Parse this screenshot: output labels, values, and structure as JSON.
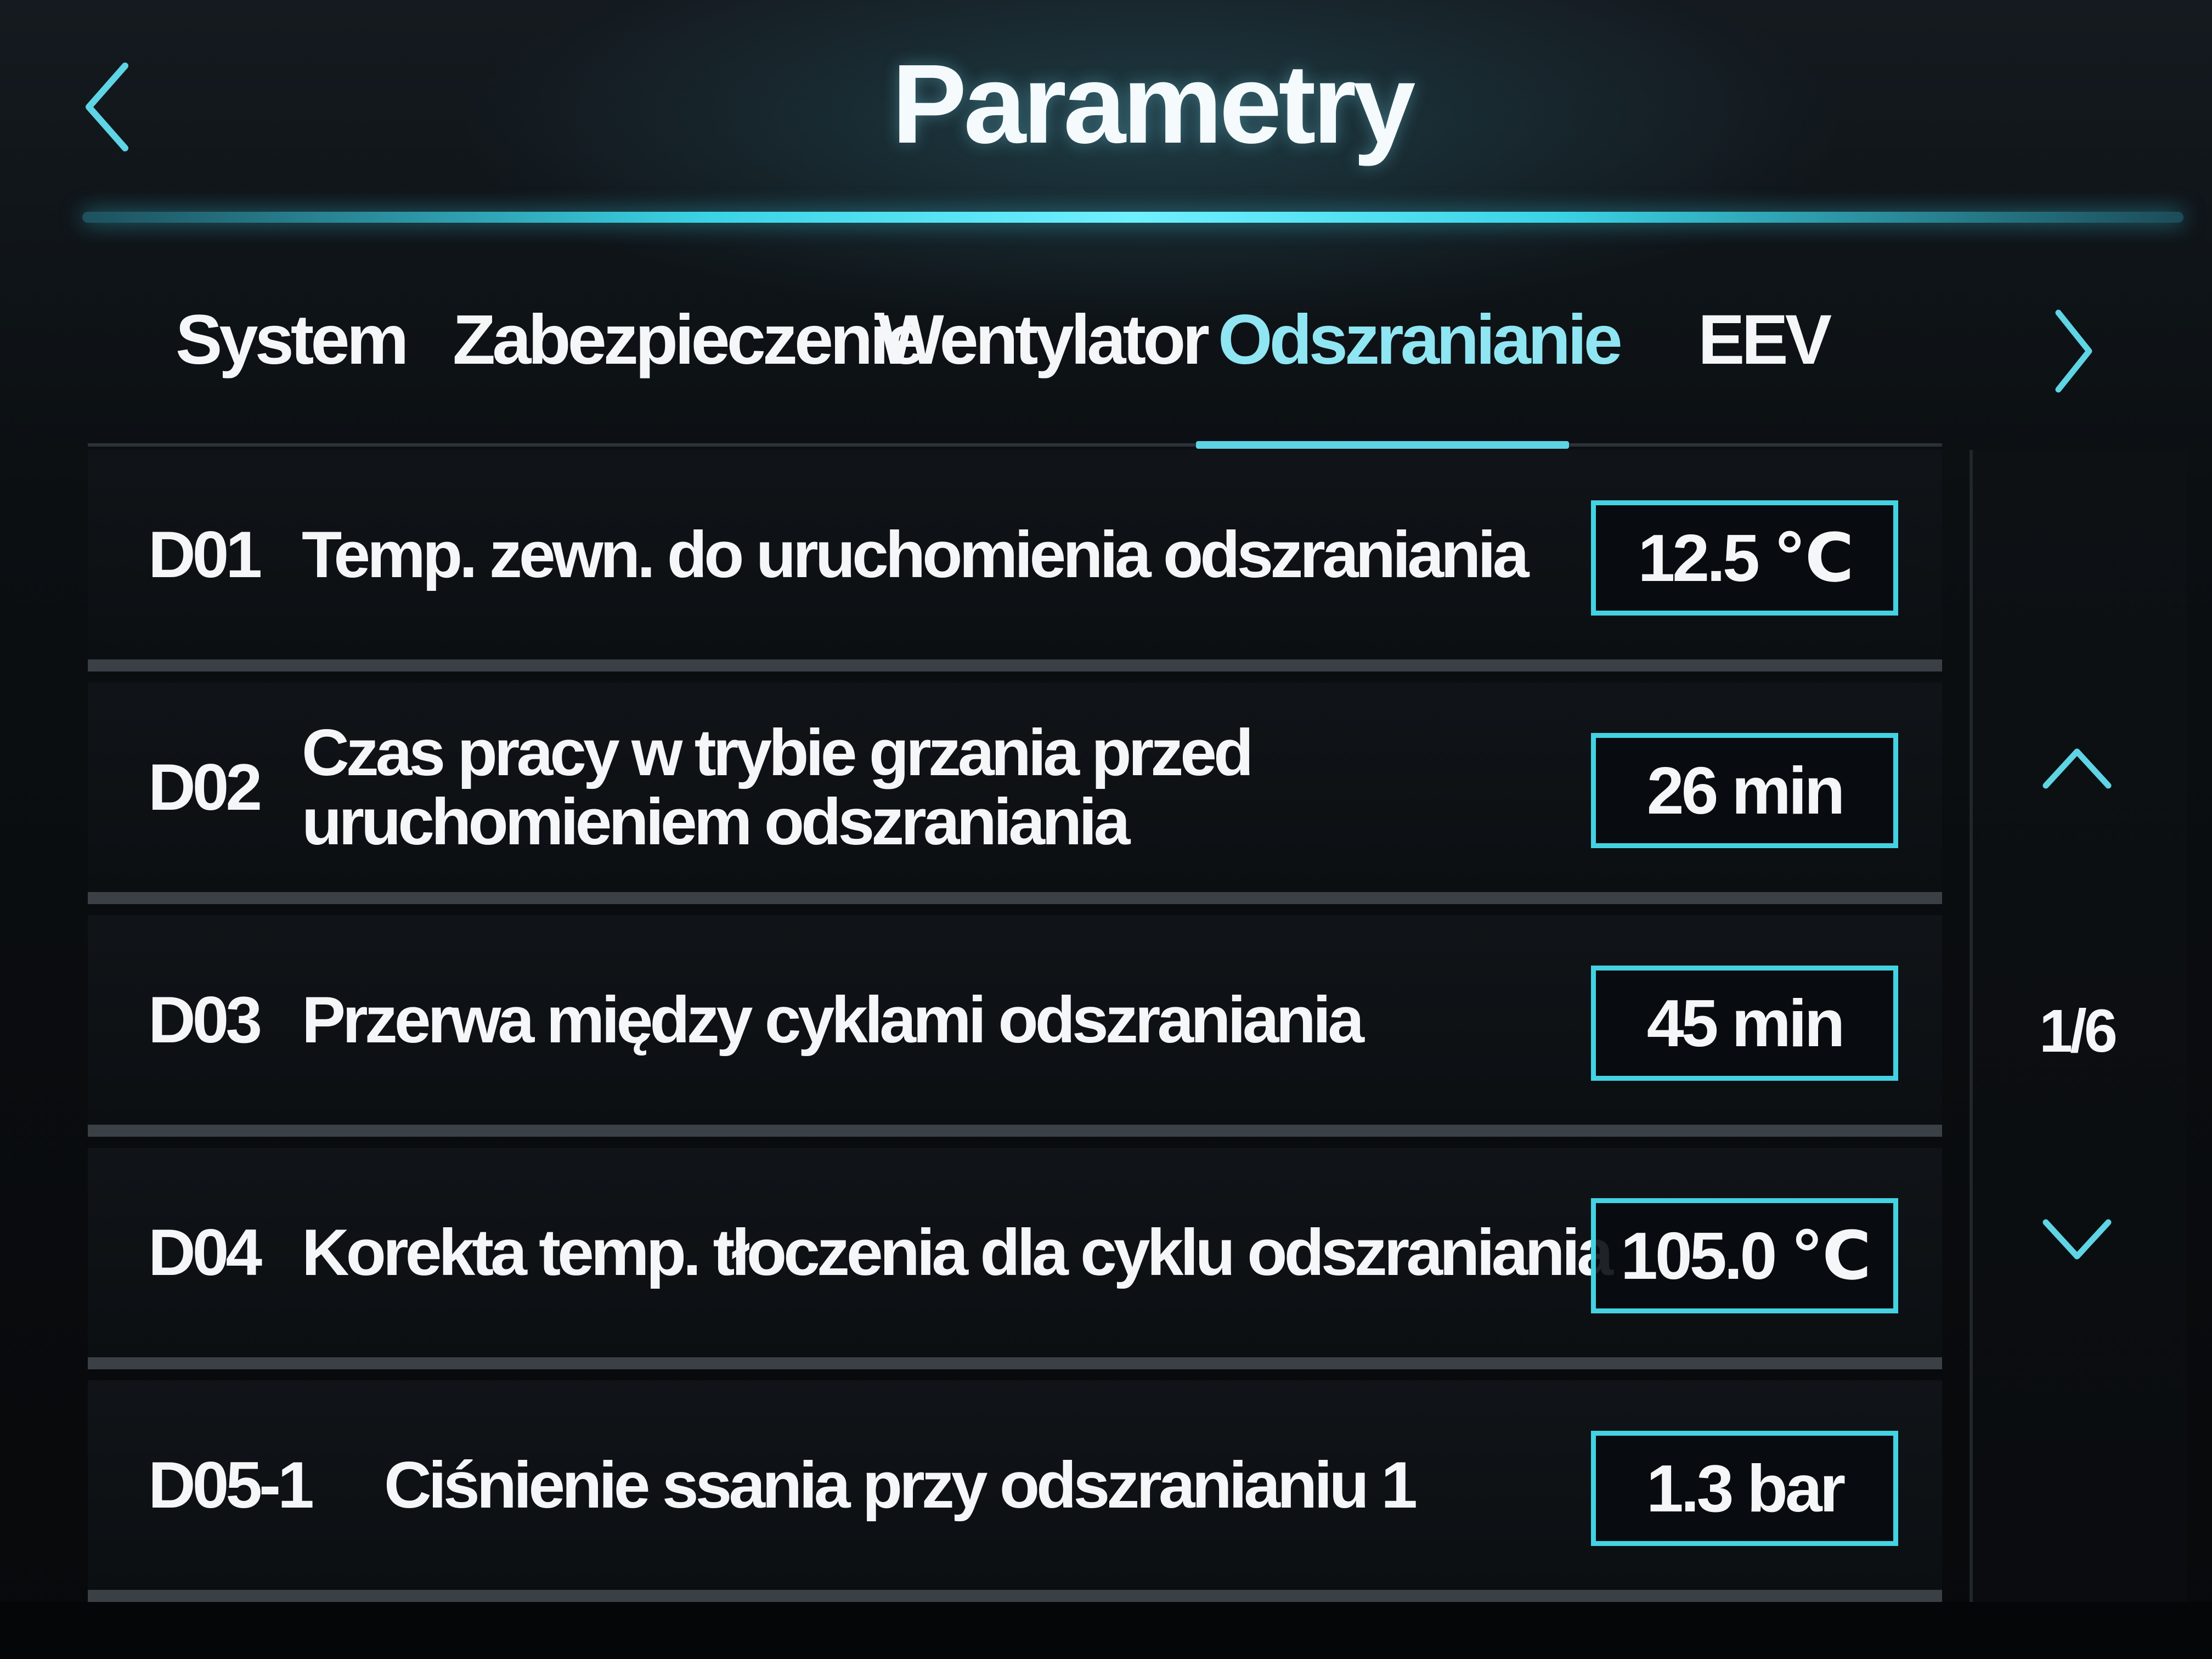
{
  "header": {
    "title": "Parametry"
  },
  "tabs": [
    {
      "label": "System",
      "active": false
    },
    {
      "label": "Zabezpieczenie",
      "active": false
    },
    {
      "label": "Wentylator",
      "active": false
    },
    {
      "label": "Odszranianie",
      "active": true
    },
    {
      "label": "EEV",
      "active": false
    }
  ],
  "parameters": [
    {
      "code": "D01",
      "description": "Temp. zewn. do uruchomienia odszraniania",
      "value": "12.5 ℃"
    },
    {
      "code": "D02",
      "description": "Czas pracy w trybie grzania przed uruchomieniem odszraniania",
      "value": "26 min"
    },
    {
      "code": "D03",
      "description": "Przerwa między cyklami odszraniania",
      "value": "45 min"
    },
    {
      "code": "D04",
      "description": "Korekta temp. tłoczenia dla cyklu odszraniania",
      "value": "105.0 ℃"
    },
    {
      "code": "D05-1",
      "description": "Ciśnienie ssania przy odszranianiu 1",
      "value": "1.3 bar"
    }
  ],
  "pager": {
    "indicator": "1/6"
  },
  "icons": {
    "back": "chevron-left-icon",
    "next_tab": "chevron-right-icon",
    "page_up": "chevron-up-icon",
    "page_down": "chevron-down-icon"
  },
  "colors": {
    "accent": "#44d2e2",
    "active_tab": "#8fe6f2",
    "background": "#0b0f12",
    "text": "#f4f6f8"
  }
}
